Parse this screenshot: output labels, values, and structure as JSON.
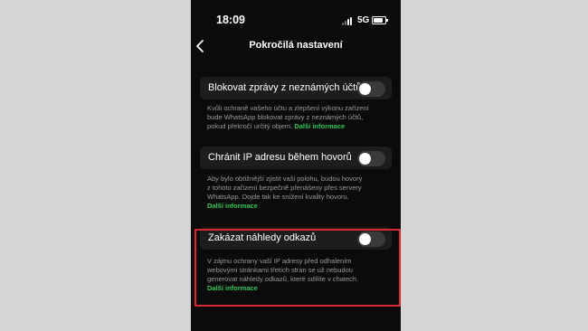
{
  "status_bar": {
    "time": "18:09",
    "network": "5G"
  },
  "header": {
    "title": "Pokročilá nastavení",
    "back_icon": "chevron-left-icon"
  },
  "settings": [
    {
      "label": "Blokovat zprávy z neznámých účtů",
      "toggle_on": false,
      "lines": [
        "Kvůli ochraně vašeho účtu a zlepšení výkonu zařízení",
        "bude WhatsApp blokovat zprávy z neznámých účtů,",
        "pokud překročí určitý objem."
      ],
      "link": "Další informace"
    },
    {
      "label": "Chránit IP adresu během hovorů",
      "toggle_on": false,
      "lines": [
        "Aby bylo obtížnější zjistit vaši polohu, budou hovory",
        "z tohoto zařízení bezpečně přenášeny přes servery",
        "WhatsApp. Dojde tak ke snížení kvality hovoru."
      ],
      "link": "Další informace"
    },
    {
      "label": "Zakázat náhledy odkazů",
      "toggle_on": false,
      "lines": [
        "V zájmu ochrany vaší IP adresy před odhalením",
        "webovými stránkami třetích stran se už nebudou",
        "generovat náhledy odkazů, které sdílíte v chatech."
      ],
      "link": "Další informace"
    }
  ],
  "colors": {
    "link": "#35c85a",
    "highlight_border": "#d7282d",
    "background": "#0b0b0b"
  }
}
